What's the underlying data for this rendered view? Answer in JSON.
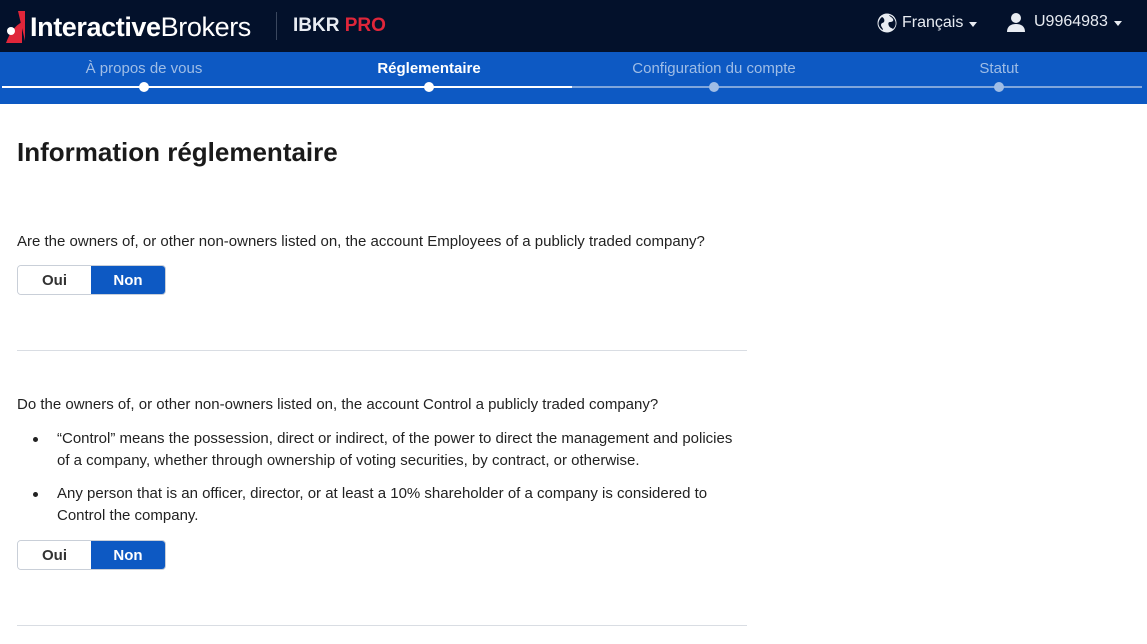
{
  "header": {
    "logo_bold": "Interactive",
    "logo_regular": "Brokers",
    "product_name": "IBKR",
    "product_suffix": "PRO",
    "language": "Français",
    "user_id": "U9964983",
    "colors": {
      "bg": "#03112b",
      "accent_red": "#e0263a"
    }
  },
  "steps": [
    {
      "label": "À propos de vous",
      "state": "done"
    },
    {
      "label": "Réglementaire",
      "state": "active"
    },
    {
      "label": "Configuration du compte",
      "state": "pending"
    },
    {
      "label": "Statut",
      "state": "pending"
    }
  ],
  "main": {
    "title": "Information réglementaire",
    "questions": [
      {
        "text": "Are the owners of, or other non-owners listed on, the account Employees of a publicly traded company?",
        "yes_label": "Oui",
        "no_label": "Non",
        "selected": "Non"
      },
      {
        "text": "Do the owners of, or other non-owners listed on, the account Control a publicly traded company?",
        "bullets": [
          "“Control” means the possession, direct or indirect, of the power to direct the management and policies of a company, whether through ownership of voting securities, by contract, or otherwise.",
          "Any person that is an officer, director, or at least a 10% shareholder of a company is considered to Control the company."
        ],
        "yes_label": "Oui",
        "no_label": "Non",
        "selected": "Non"
      }
    ]
  },
  "colors": {
    "brand_blue": "#0d59c3",
    "inactive_step": "#9fbde6"
  }
}
